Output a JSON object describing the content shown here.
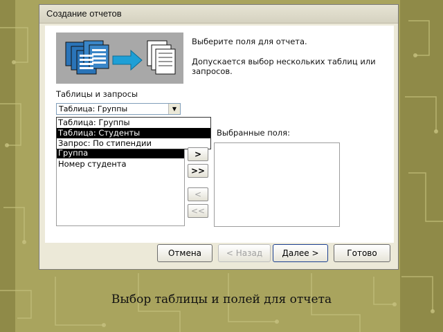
{
  "dialog": {
    "title": "Создание отчетов",
    "hint_line1": "Выберите поля для отчета.",
    "hint_line2": "Допускается выбор нескольких таблиц или запросов.",
    "tables_label": "Таблицы и запросы",
    "combo_value": "Таблица: Группы",
    "available_fields": [
      "Группа",
      "Номер студента"
    ],
    "selected_fields_label": "Выбранные поля:",
    "dropdown_options": [
      {
        "label": "Таблица: Группы",
        "selected": false
      },
      {
        "label": "Таблица: Студенты",
        "selected": true
      },
      {
        "label": "Запрос: По стипендии",
        "selected": false
      }
    ],
    "transfer_buttons": [
      ">",
      ">>",
      "<",
      "<<"
    ],
    "buttons": {
      "cancel": "Отмена",
      "back": "< Назад",
      "next": "Далее >",
      "finish": "Готово"
    }
  },
  "caption": "Выбор таблицы и полей для отчета",
  "icons": [
    "table-stack-icon",
    "arrow-right-icon",
    "report-stack-icon",
    "dropdown-arrow-icon"
  ],
  "colors": {
    "selection": "#000000",
    "illustration_bg": "#a8a8a8",
    "slide_bg": "#a9a45e",
    "arrow": "#1e9fd6"
  }
}
